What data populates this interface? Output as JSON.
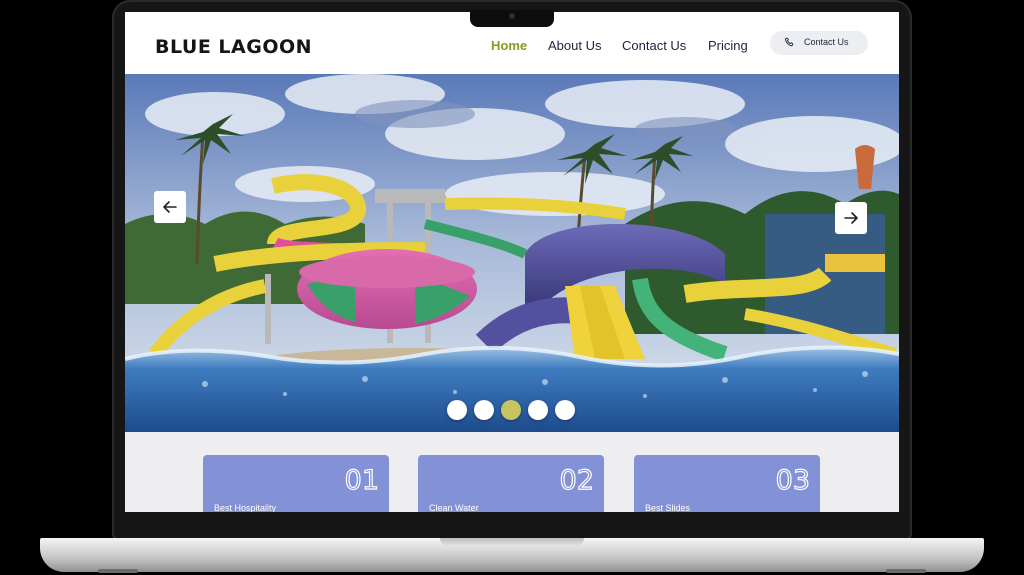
{
  "site": {
    "brand": "BLUE LAGOON"
  },
  "nav": {
    "items": [
      {
        "label": "Home",
        "active": true
      },
      {
        "label": "About Us",
        "active": false
      },
      {
        "label": "Contact Us",
        "active": false
      },
      {
        "label": "Pricing",
        "active": false
      }
    ],
    "contact_button": {
      "label": "Contact Us",
      "icon": "phone-icon"
    }
  },
  "hero": {
    "image": "water-park-slides",
    "prev_icon": "arrow-left-icon",
    "next_icon": "arrow-right-icon",
    "slide_count": 5,
    "active_slide": 3
  },
  "features": [
    {
      "number": "01",
      "title": "Best Hospitality"
    },
    {
      "number": "02",
      "title": "Clean Water"
    },
    {
      "number": "03",
      "title": "Best Slides"
    }
  ],
  "colors": {
    "accent_active_nav": "#8a9a1e",
    "card_bg": "#8391d6",
    "active_dot": "#c8c462"
  }
}
